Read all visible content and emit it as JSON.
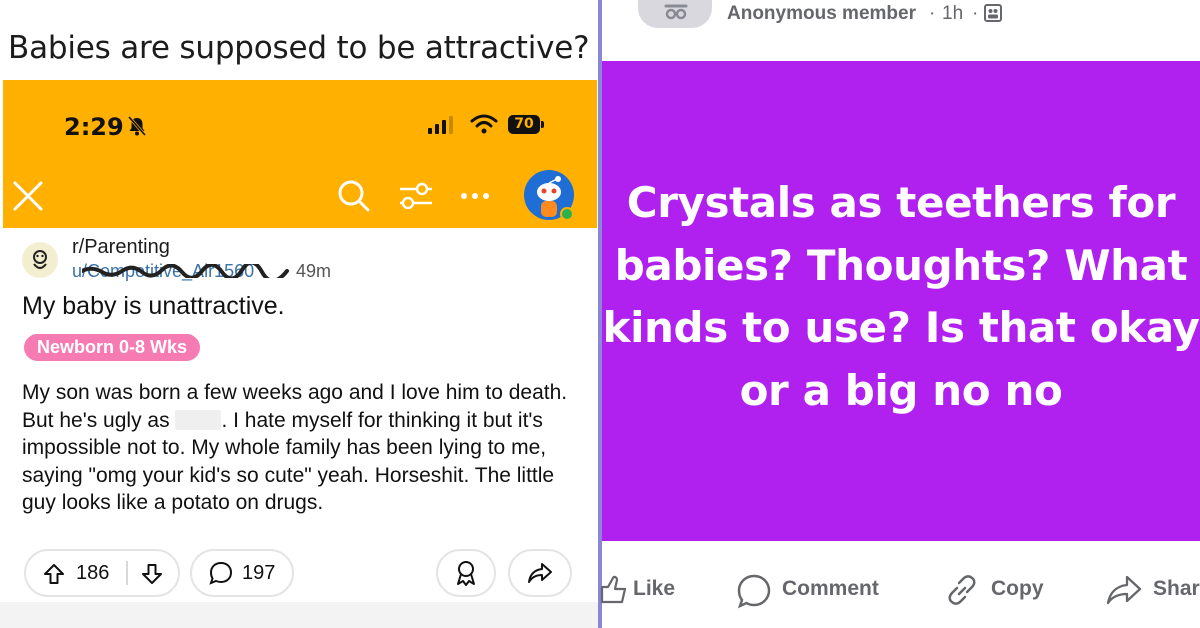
{
  "left_panel": {
    "headline": "Babies are supposed to be attractive?",
    "status_bar": {
      "time": "2:29",
      "battery": "70"
    },
    "post": {
      "subreddit": "r/Parenting",
      "username": "u/Competitive_Air1560",
      "age": "49m",
      "title": "My baby is unattractive.",
      "flair": "Newborn 0-8 Wks",
      "body_before_redaction": "My son was born a few weeks ago and I love him to death. But he's ugly as ",
      "body_after_redaction": ". I hate myself for thinking it but it's impossible not to. My whole family has been lying to me, saying \"omg your kid's so cute\" yeah. Horseshit. The little guy looks like a potato on drugs.",
      "upvotes": "186",
      "comments": "197"
    },
    "icons": [
      "close-icon",
      "search-icon",
      "filter-icon",
      "more-icon",
      "upvote-icon",
      "downvote-icon",
      "comment-icon",
      "award-icon",
      "share-icon",
      "bell-off-icon",
      "signal-icon",
      "wifi-icon"
    ],
    "colors": {
      "header_bg": "#ffb000",
      "flair_bg": "#f67bb3",
      "avatar_bg": "#1f6ed6"
    }
  },
  "right_panel": {
    "author": "Anonymous member",
    "time": "1h",
    "separator": "·",
    "post_text": "Crystals as teethers for babies? Thoughts? What kinds to use? Is that okay or a big no no",
    "actions": {
      "like": "Like",
      "comment": "Comment",
      "copy": "Copy",
      "share": "Shar"
    },
    "icons": [
      "anonymous-icon",
      "group-icon",
      "like-icon",
      "comment-icon",
      "copy-link-icon",
      "share-icon"
    ],
    "colors": {
      "post_bg": "#b021f0",
      "divider": "#8a86d8"
    }
  }
}
